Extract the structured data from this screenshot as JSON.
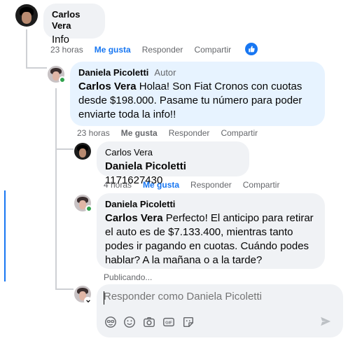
{
  "comment_1": {
    "author": "Carlos Vera",
    "text": "Info",
    "time": "23 horas",
    "like_label": "Me gusta",
    "reply_label": "Responder",
    "share_label": "Compartir",
    "reaction": "like-icon"
  },
  "reply_1": {
    "author": "Daniela Picoletti",
    "role": "Autor",
    "mention": "Carlos Vera",
    "text": " Holaa! Son Fiat Cronos con cuotas desde $198.000. Pasame tu número para poder enviarte toda la info!!",
    "time": "23 horas",
    "like_label": "Me gusta",
    "reply_label": "Responder",
    "share_label": "Compartir"
  },
  "reply_2": {
    "author": "Carlos Vera",
    "mention": "Daniela Picoletti",
    "text": " 1171627430",
    "time": "4 horas",
    "like_label": "Me gusta",
    "reply_label": "Responder",
    "share_label": "Compartir"
  },
  "reply_3": {
    "author": "Daniela Picoletti",
    "mention": "Carlos Vera",
    "text": " Perfecto! El anticipo para retirar el auto es de $7.133.400, mientras tanto podes ir pagando en cuotas. Cuándo podes hablar? A la mañana o a la tarde?",
    "status": "Publicando..."
  },
  "composer": {
    "placeholder": "Responder como Daniela Picoletti",
    "tools": [
      "avatar-sticker-icon",
      "emoji-icon",
      "camera-icon",
      "gif-icon",
      "sticker-icon"
    ],
    "send": "send-icon"
  },
  "colors": {
    "accent": "#1877f2",
    "bubble_grey": "#f0f2f5",
    "bubble_author": "#e7f3ff",
    "online": "#31a24c",
    "meta_text": "#65676b"
  }
}
